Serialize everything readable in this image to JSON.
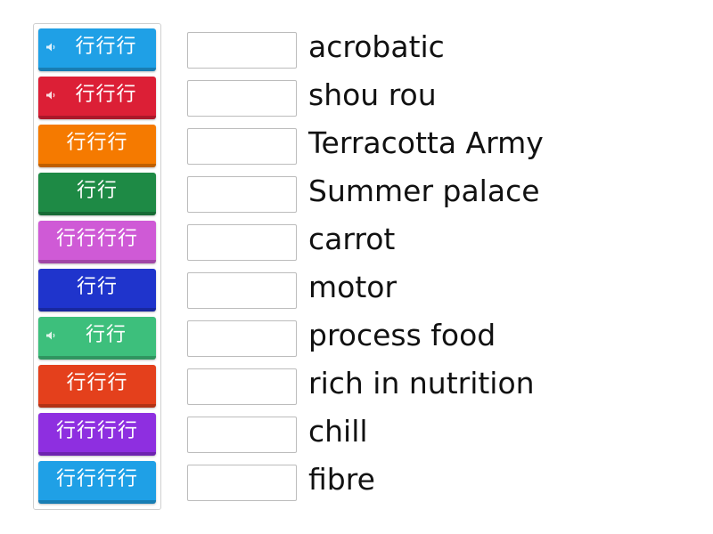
{
  "tiles": [
    {
      "text": "行行行",
      "color": "#1fa0e6",
      "audio": true
    },
    {
      "text": "行行行",
      "color": "#dc1f36",
      "audio": true
    },
    {
      "text": "行行行",
      "color": "#f57a00",
      "audio": false
    },
    {
      "text": "行行",
      "color": "#1e8a45",
      "audio": false
    },
    {
      "text": "行行行行",
      "color": "#cf5ad6",
      "audio": false
    },
    {
      "text": "行行",
      "color": "#1f34cc",
      "audio": false
    },
    {
      "text": "行行",
      "color": "#3dbf7c",
      "audio": true
    },
    {
      "text": "行行行",
      "color": "#e4401c",
      "audio": false
    },
    {
      "text": "行行行行",
      "color": "#8e2fe0",
      "audio": false
    },
    {
      "text": "行行行行",
      "color": "#1fa0e6",
      "audio": false
    }
  ],
  "answers": [
    "acrobatic",
    "shou rou",
    "Terracotta Army",
    "Summer palace",
    "carrot",
    "motor",
    "process food",
    "rich in nutrition",
    "chill",
    "fibre"
  ],
  "icons": {
    "audio": "speaker-icon"
  }
}
